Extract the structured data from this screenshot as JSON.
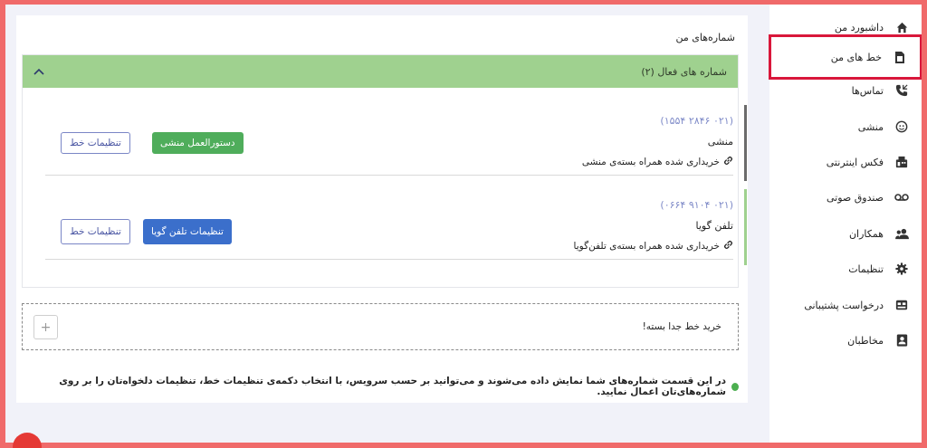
{
  "sidebar": {
    "items": [
      {
        "label": "داشبورد من",
        "icon": "home-icon"
      },
      {
        "label": "خط های من",
        "icon": "sim-card-icon"
      },
      {
        "label": "تماس‌ها",
        "icon": "phone-call-icon"
      },
      {
        "label": "منشی",
        "icon": "headset-icon"
      },
      {
        "label": "فکس اینترنتی",
        "icon": "fax-icon"
      },
      {
        "label": "صندوق صوتی",
        "icon": "voicemail-icon"
      },
      {
        "label": "همکاران",
        "icon": "users-icon"
      },
      {
        "label": "تنظیمات",
        "icon": "gear-icon"
      },
      {
        "label": "درخواست پشتیبانی",
        "icon": "support-icon"
      },
      {
        "label": "مخاطبان",
        "icon": "contact-icon"
      }
    ]
  },
  "main": {
    "title": "شماره‌های من",
    "panel_title": "شماره های فعال (۲)",
    "lines": [
      {
        "number": "(۰۲۱ ۲۸۴۶ ۱۵۵۴)",
        "type": "منشی",
        "note": "خریداری شده همراه بسته‌ی منشی",
        "primary_button": "دستورالعمل منشی",
        "settings_button": "تنظیمات خط",
        "accent": "#4fad5b"
      },
      {
        "number": "(۰۲۱ ۹۱۰۴ ۰۶۶۴)",
        "type": "تلفن گویا",
        "note": "خریداری شده همراه بسته‌ی تلفن‌گویا",
        "primary_button": "تنظیمات تلفن گویا",
        "settings_button": "تنظیمات خط",
        "accent": "#3b6fcb"
      }
    ],
    "buy_label": "خرید خط جدا بسته!",
    "info_text": "در این قسمت شماره‌های شما نمایش داده می‌شوند و می‌توانید بر حسب سرویس، با انتخاب دکمه‌ی تنظیمات خط، تنظیمات دلخواه‌تان را بر روی شماره‌های‌تان اعمال نمایید."
  },
  "colors": {
    "panel_header": "#9fd18f",
    "highlight": "#d9173b",
    "line1_bar": "#6b6b6b",
    "line2_bar": "#9fd18f"
  }
}
